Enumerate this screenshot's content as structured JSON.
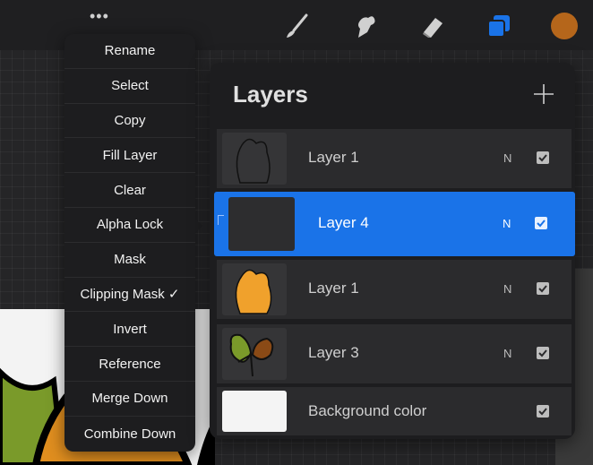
{
  "toolbar": {
    "more_label": "•••"
  },
  "context_menu": {
    "items": [
      {
        "label": "Rename"
      },
      {
        "label": "Select"
      },
      {
        "label": "Copy"
      },
      {
        "label": "Fill Layer"
      },
      {
        "label": "Clear"
      },
      {
        "label": "Alpha Lock"
      },
      {
        "label": "Mask"
      },
      {
        "label": "Clipping Mask ✓"
      },
      {
        "label": "Invert"
      },
      {
        "label": "Reference"
      },
      {
        "label": "Merge Down"
      },
      {
        "label": "Combine Down"
      }
    ]
  },
  "layers_panel": {
    "title": "Layers",
    "add_label": "+",
    "layers": [
      {
        "name": "Layer 1",
        "blend": "N",
        "visible": true,
        "selected": false
      },
      {
        "name": "Layer 4",
        "blend": "N",
        "visible": true,
        "selected": true
      },
      {
        "name": "Layer 1",
        "blend": "N",
        "visible": true,
        "selected": false
      },
      {
        "name": "Layer 3",
        "blend": "N",
        "visible": true,
        "selected": false
      },
      {
        "name": "Background color",
        "blend": "",
        "visible": true,
        "selected": false
      }
    ]
  },
  "colors": {
    "accent": "#1a73e8",
    "current_color": "#b5661b",
    "panel_bg": "#1d1d1f"
  }
}
